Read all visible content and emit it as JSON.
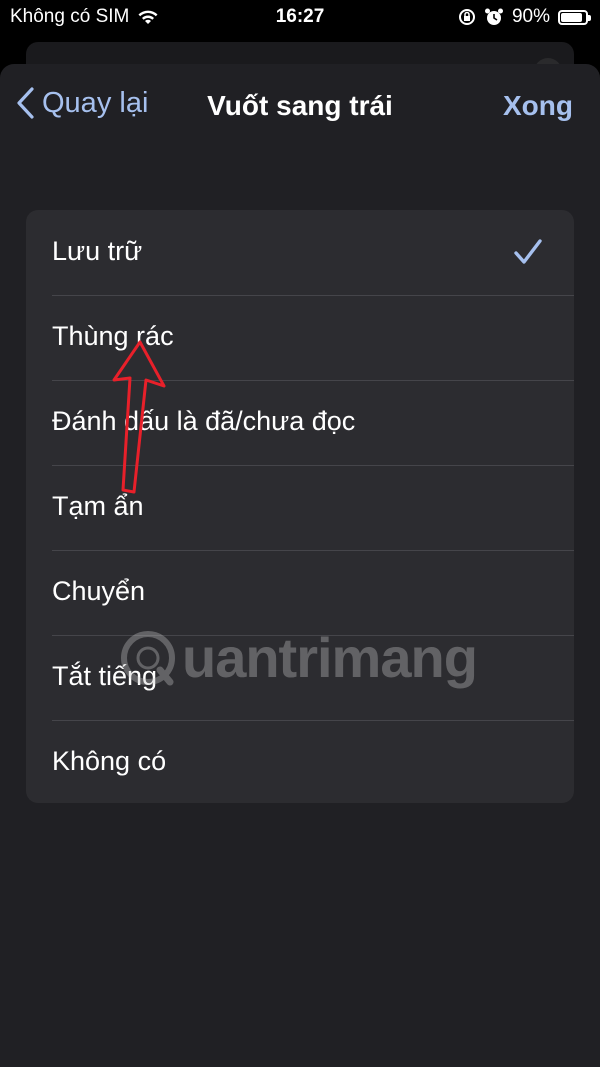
{
  "status_bar": {
    "carrier": "Không có SIM",
    "time": "16:27",
    "battery_percent": "90%",
    "battery_level": 0.9,
    "icons": [
      "wifi-icon",
      "rotation-lock-icon",
      "alarm-icon",
      "battery-icon"
    ]
  },
  "nav": {
    "back_label": "Quay lại",
    "title": "Vuốt sang trái",
    "done_label": "Xong"
  },
  "options": [
    {
      "label": "Lưu trữ",
      "selected": true
    },
    {
      "label": "Thùng rác",
      "selected": false
    },
    {
      "label": "Đánh dấu là đã/chưa đọc",
      "selected": false
    },
    {
      "label": "Tạm ẩn",
      "selected": false
    },
    {
      "label": "Chuyển",
      "selected": false
    },
    {
      "label": "Tắt tiếng",
      "selected": false
    },
    {
      "label": "Không có",
      "selected": false
    }
  ],
  "watermark": {
    "text": "uantrimang"
  },
  "colors": {
    "accent": "#a6c0ee",
    "sheet_bg": "#202024",
    "group_bg": "#2c2c30",
    "annotation": "#e8202a"
  }
}
